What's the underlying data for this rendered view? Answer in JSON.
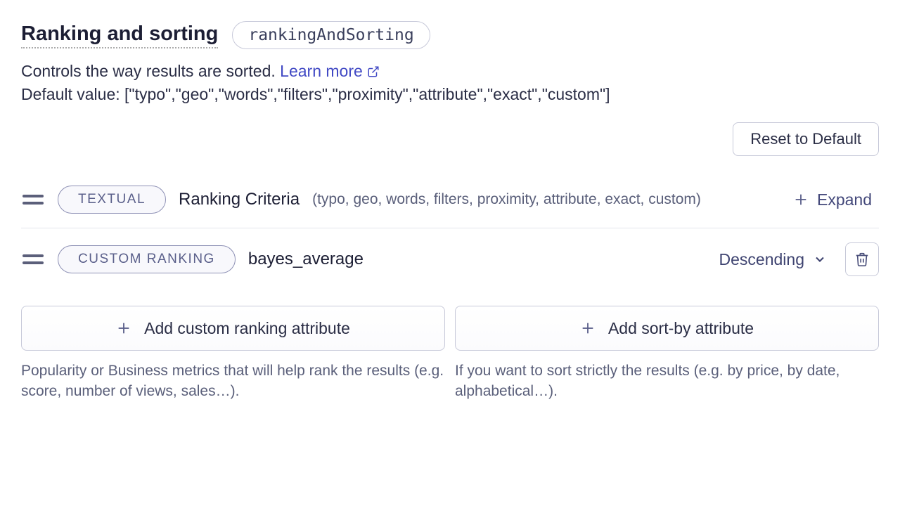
{
  "header": {
    "title": "Ranking and sorting",
    "api_name": "rankingAndSorting"
  },
  "description": {
    "text": "Controls the way results are sorted. ",
    "learn_more": "Learn more"
  },
  "default_line": "Default value: [\"typo\",\"geo\",\"words\",\"filters\",\"proximity\",\"attribute\",\"exact\",\"custom\"]",
  "reset_label": "Reset to Default",
  "rows": {
    "textual": {
      "tag": "TEXTUAL",
      "name": "Ranking Criteria",
      "detail": "(typo, geo, words, filters, proximity, attribute, exact, custom)",
      "expand": "Expand"
    },
    "custom": {
      "tag": "CUSTOM RANKING",
      "name": "bayes_average",
      "order": "Descending"
    }
  },
  "add": {
    "custom_ranking": {
      "button": "Add custom ranking attribute",
      "help": "Popularity or Business metrics that will help rank the results (e.g. score, number of views, sales…)."
    },
    "sort_by": {
      "button": "Add sort-by attribute",
      "help": "If you want to sort strictly the results (e.g. by price, by date, alphabetical…)."
    }
  }
}
